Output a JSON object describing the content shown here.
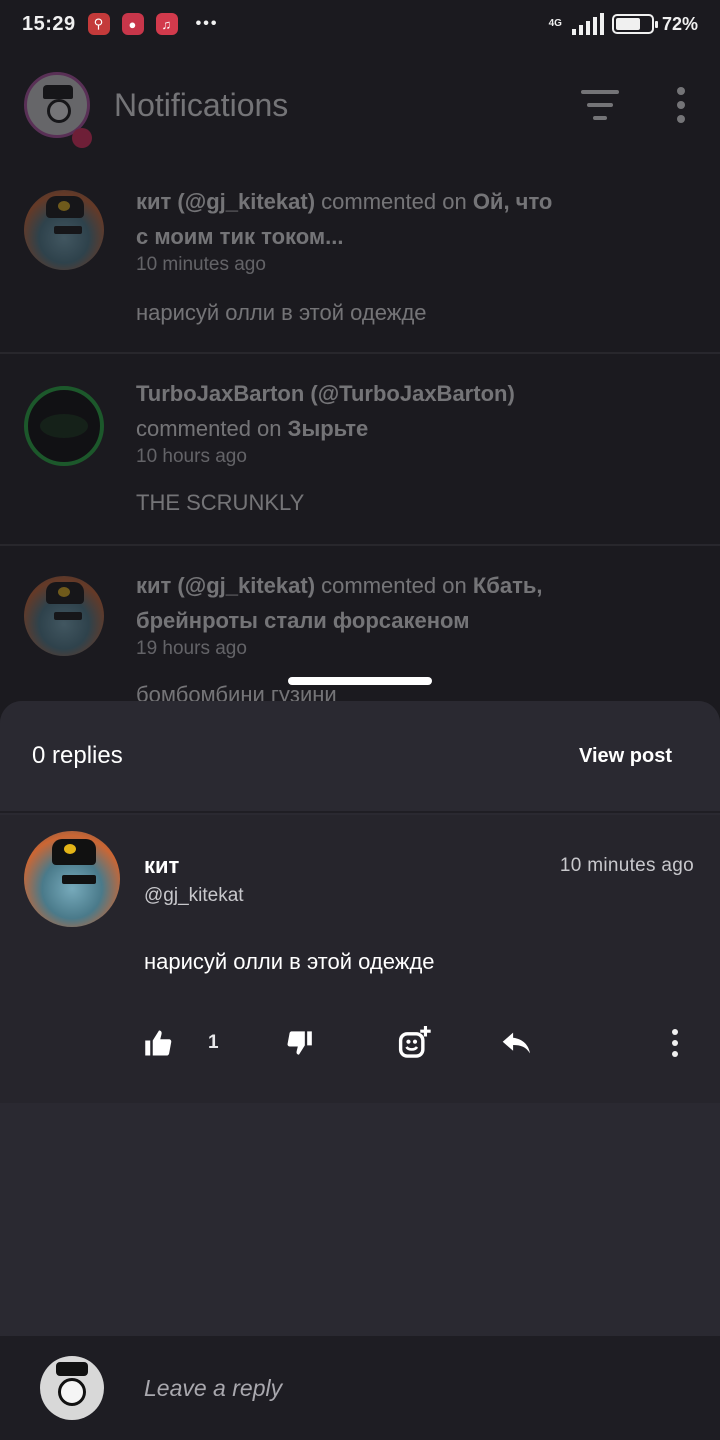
{
  "status_bar": {
    "time": "15:29",
    "time_display": "15",
    "time_display2": "29",
    "network": "4G",
    "battery_percent": 72,
    "battery_label": "72%",
    "app_icons": [
      "pin-app-icon",
      "chat-app-icon",
      "music-app-icon"
    ],
    "overflow": "•••"
  },
  "header": {
    "title": "Notifications",
    "has_unread_dot": true
  },
  "notifications": [
    {
      "user": "кит (@gj_kitekat)",
      "action": "commented on",
      "target_line1": "Ой, что",
      "target_line2": "с моим тик током...",
      "time": "10 minutes ago",
      "body": "нарисуй олли в этой одежде"
    },
    {
      "user": "TurboJaxBarton (@TurboJaxBarton)",
      "action": "commented on",
      "target": "Зырьте",
      "time": "10 hours ago",
      "body": "THE SCRUNKLY"
    },
    {
      "user": "кит (@gj_kitekat)",
      "action": "commented on",
      "target_line1": "Кбать,",
      "target_line2": "брейнроты стали форсакеном",
      "time": "19 hours ago",
      "body": "бомбомбини гузини"
    }
  ],
  "sheet": {
    "replies_label": "0 replies",
    "view_post_label": "View post",
    "comment": {
      "name": "кит",
      "handle": "@gj_kitekat",
      "time": "10 minutes ago",
      "text": "нарисуй олли в этой одежде",
      "like_count": "1"
    },
    "reply_placeholder": "Leave a reply"
  },
  "colors": {
    "background": "#1b1a1f",
    "sheet": "#2a2931",
    "avatar_ring": "#b04fa3",
    "unread_dot": "#e2285a",
    "turbo_ring": "#1fae3c"
  }
}
